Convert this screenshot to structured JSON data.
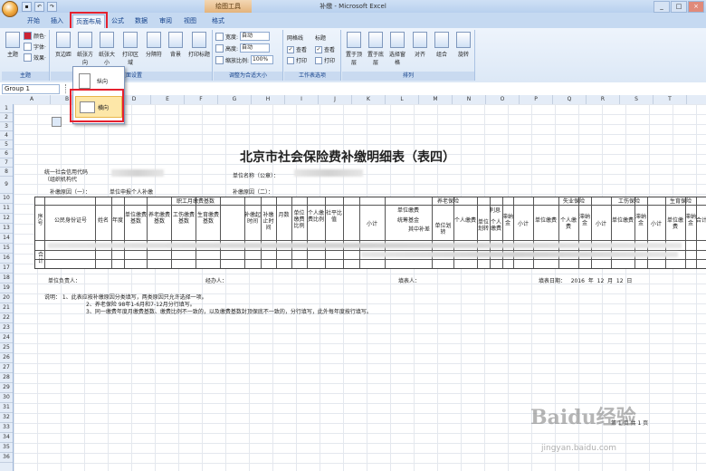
{
  "window": {
    "context_tool": "绘图工具",
    "title": "补缴 - Microsoft Excel"
  },
  "tabs": [
    "开始",
    "插入",
    "页面布局",
    "公式",
    "数据",
    "审阅",
    "视图",
    "格式"
  ],
  "active_tab": "页面布局",
  "ribbon": {
    "themes": {
      "big": "主题",
      "colors": "颜色·",
      "fonts": "字体·",
      "effects": "效果·",
      "label": "主题"
    },
    "page_setup": {
      "buttons": [
        "页边距",
        "纸张方向",
        "纸张大小",
        "打印区域",
        "分隔符",
        "背景",
        "打印标题"
      ],
      "label": "页面设置"
    },
    "scale": {
      "width_label": "宽度:",
      "width_val": "自动",
      "height_label": "高度:",
      "height_val": "自动",
      "zoom_label": "缩放比例:",
      "zoom_val": "100%",
      "label": "调整为合适大小"
    },
    "sheet_options": {
      "gridlines": "网格线",
      "headings": "标题",
      "view": "查看",
      "print": "打印",
      "label": "工作表选项"
    },
    "arrange": {
      "buttons": [
        "置于顶层",
        "置于底层",
        "选择窗格",
        "对齐",
        "组合",
        "旋转"
      ],
      "label": "排列"
    }
  },
  "orientation_menu": {
    "portrait": "纵向",
    "landscape": "横向"
  },
  "name_box": "Group 1",
  "columns": [
    "A",
    "B",
    "C",
    "D",
    "E",
    "F",
    "G",
    "H",
    "I",
    "J",
    "K",
    "L",
    "M",
    "N",
    "O",
    "P",
    "Q",
    "R",
    "S",
    "T"
  ],
  "rows": [
    "1",
    "2",
    "3",
    "4",
    "5",
    "6",
    "7",
    "8",
    "9",
    "10",
    "11",
    "12",
    "13",
    "14",
    "15",
    "16",
    "17",
    "18",
    "19",
    "20",
    "21",
    "22",
    "23",
    "24",
    "25",
    "26",
    "27",
    "28",
    "29",
    "30",
    "31",
    "32",
    "33",
    "34",
    "35",
    "36"
  ],
  "doc": {
    "title": "北京市社会保险费补缴明细表（表四）",
    "org_code": "统一社会信用代码\n（组织机构代",
    "unit_name": "单位名称（公章）：",
    "reason1": "补缴原因（一）：",
    "reason1_val": "单位申报个人补缴",
    "reason2": "补缴原因（二）：",
    "headers": {
      "seq": "序号",
      "id": "公民身份证号",
      "name": "姓名",
      "year": "年度",
      "base_group": "职工月缴费基数",
      "unit_base": "单位缴费基数",
      "pension_base": "养老缴费基数",
      "injury_base": "工伤缴费基数",
      "maternity_base": "生育缴费基数",
      "start": "补缴起时间",
      "end": "补缴止时间",
      "months": "月数",
      "unit_rate": "单位缴费比例",
      "person_rate": "个人缴费比例",
      "sum_ratio": "社平比值",
      "pension": "养老保险",
      "subtotal": "小计",
      "unit_pay": "单位缴费",
      "pool": "统筹基金",
      "of_which": "其中补差",
      "unit_transfer": "单位划转",
      "person_pay": "个人缴费",
      "interest": "利息",
      "unit_int": "单位划转",
      "person_int": "个人缴费",
      "late_fee": "滞纳金",
      "unemployment": "失业保险",
      "injury": "工伤保险",
      "maternity": "生育保险",
      "total": "合计"
    },
    "row_total": "合计",
    "footer_unit_resp": "单位负责人：",
    "footer_manager": "经办人：",
    "footer_filler": "填表人：",
    "footer_date": "填表日期：   2016  年  12  月  12  日",
    "notes": [
      "说明：  1、此表应按补缴原因分类填写，两类原因只允许选择一项。",
      "2、养老保险 98年1-6月和7-12月分行填写。",
      "3、同一缴费年度月缴费基数、缴费比例不一致的，以及缴费基数封顶保底不一致的，分行填写，此外每年度按行填写。"
    ],
    "page_label": "第 1 页 共 1 页"
  },
  "watermark": {
    "brand": "Baidu经验",
    "url": "jingyan.baidu.com"
  }
}
